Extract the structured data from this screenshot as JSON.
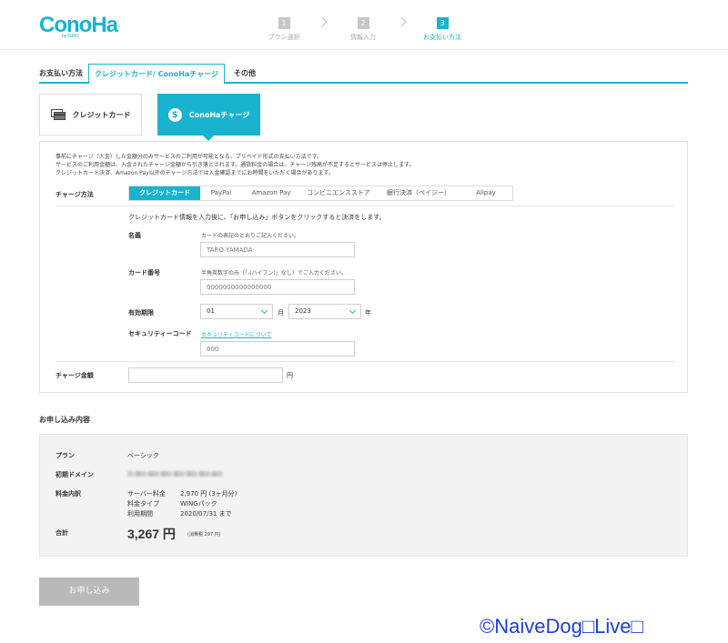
{
  "header": {
    "logo": "ConoHa",
    "logo_sub": "by GMO",
    "steps": [
      {
        "num": "1",
        "label": "プラン選択"
      },
      {
        "num": "2",
        "label": "情報入力"
      },
      {
        "num": "3",
        "label": "お支払い方法"
      }
    ]
  },
  "top_tabs": {
    "label": "お支払い方法",
    "items": [
      "クレジットカード/ ConoHaチャージ",
      "その他"
    ]
  },
  "method_cards": {
    "credit_card": "クレジットカード",
    "conoha_charge": "ConoHaチャージ",
    "coin_symbol": "$"
  },
  "form": {
    "description": [
      "事前にチャージ（入金）した金額分のみサービスのご利用が可能となる、プリペイド形式の支払い方法です。",
      "サービスのご利用金額は、入金されたチャージ金額から引き落とされます。通貨料金の場合は、チャージ残高が不足するとサービスは停止します。",
      "クレジットカード決済、Amazon Pay以外のチャージ方法では入金確認までにお時間をいただく場合があります。"
    ],
    "charge_method_label": "チャージ方法",
    "charge_methods": [
      "クレジットカード",
      "PayPal",
      "Amazon Pay",
      "コンビニエンスストア",
      "銀行決済（ペイジー）",
      "Alipay"
    ],
    "instruction": "クレジットカード情報を入力後に、「お申し込み」ボタンをクリックすると決済をします。",
    "name_label": "名義",
    "name_hint": "カードの表記のとおりご記入ください。",
    "name_placeholder": "TARO YAMADA",
    "card_label": "カード番号",
    "card_hint": "半角英数字のみ（「-(ハイフン)」なし）でご入力ください。",
    "card_placeholder": "0000000000000000",
    "expiry_label": "有効期限",
    "expiry_month": "01",
    "expiry_month_unit": "月",
    "expiry_year": "2023",
    "expiry_year_unit": "年",
    "security_label": "セキュリティーコード",
    "security_link": "セキュリティコードについて",
    "security_placeholder": "000",
    "amount_label": "チャージ金額",
    "amount_unit": "円"
  },
  "summary": {
    "title": "お申し込み内容",
    "plan_label": "プラン",
    "plan_value": "ベーシック",
    "domain_label": "初期ドメイン",
    "fee_label": "料金内訳",
    "fee_rows": [
      {
        "k": "サーバー料金",
        "v": "2,970 円 (3ヶ月分)"
      },
      {
        "k": "料金タイプ",
        "v": "WINGパック"
      },
      {
        "k": "利用期間",
        "v": "2020/07/31 まで"
      }
    ],
    "total_label": "合計",
    "total_value": "3,267 円",
    "tax_note": "(消費税 297 円)"
  },
  "submit_label": "お申し込み",
  "watermark": "©NaiveDog□Live□"
}
